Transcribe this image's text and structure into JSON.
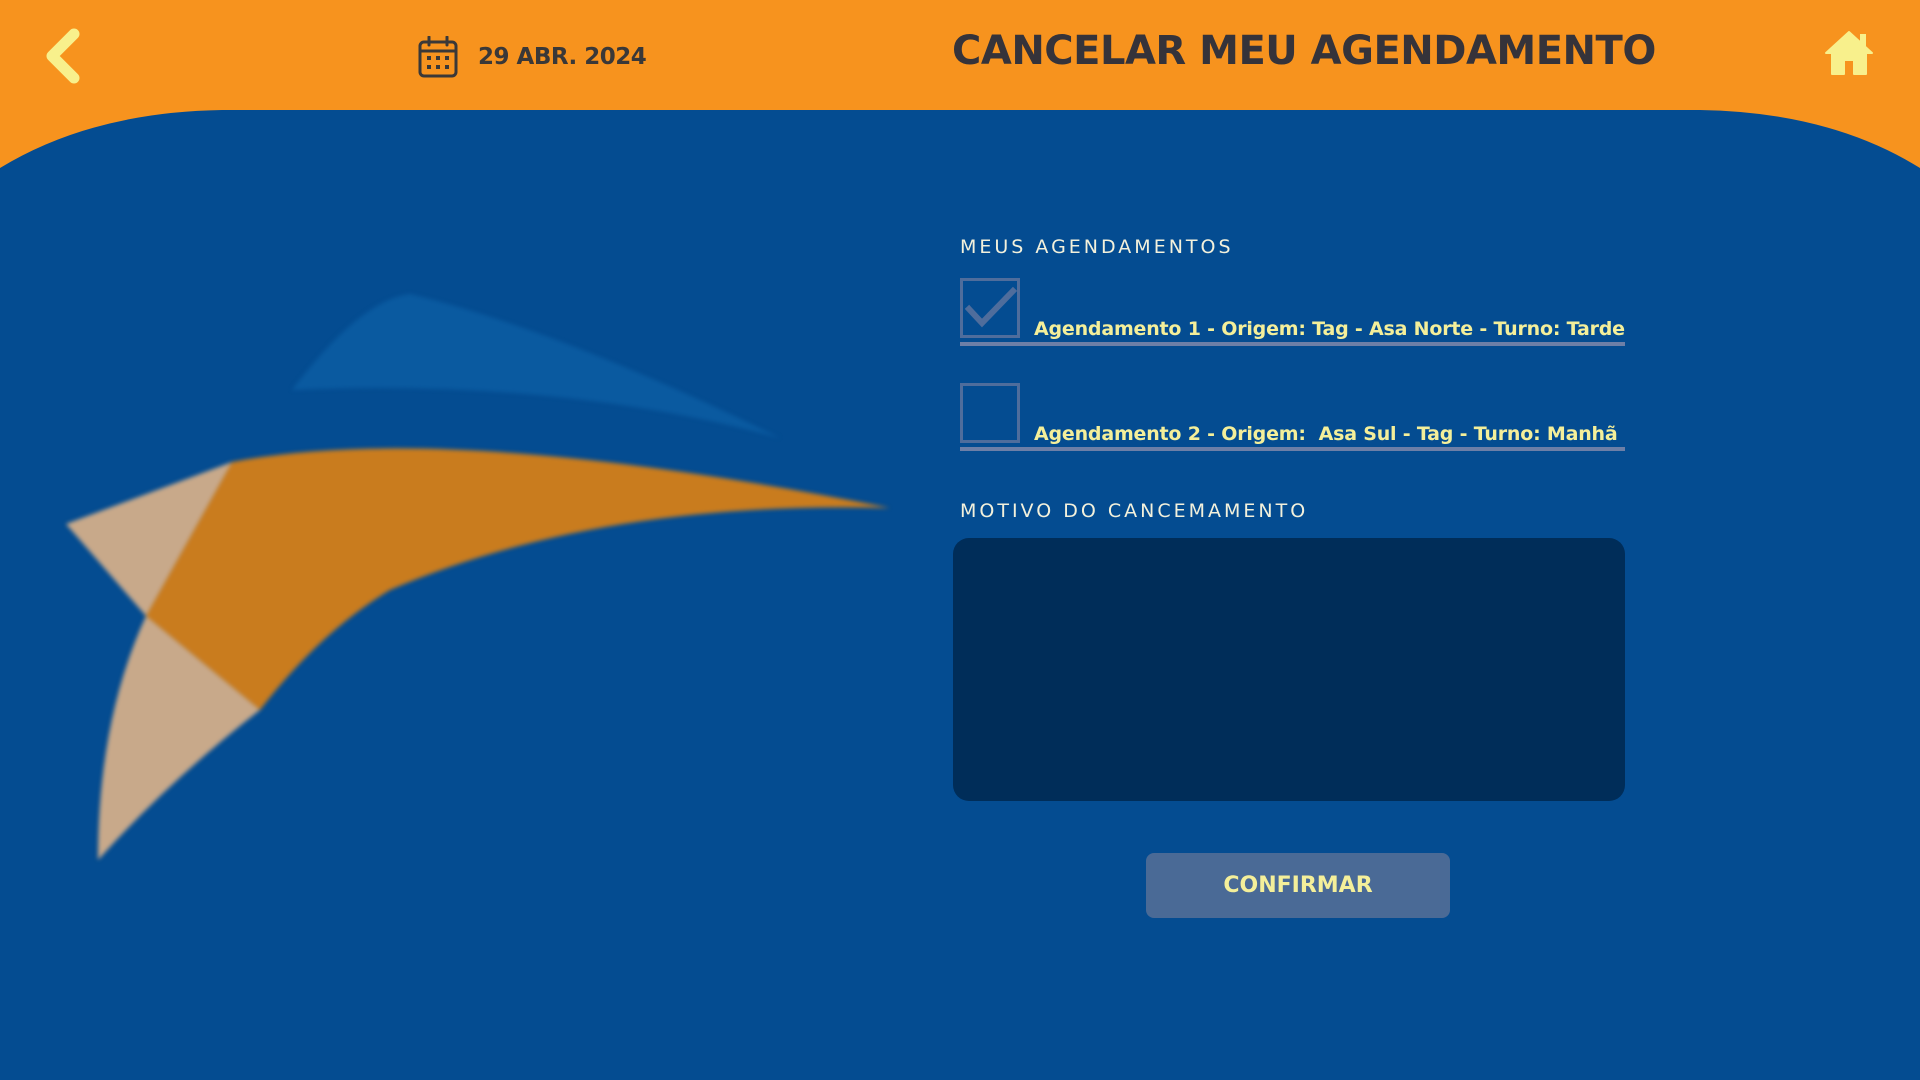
{
  "colors": {
    "header_orange": "#f7931e",
    "background_blue": "#044c91",
    "accent_yellow": "#f4ef9a",
    "dark_text": "#35333a",
    "textarea_bg": "#002d59",
    "button_bg": "#4a6a96"
  },
  "header": {
    "back_icon": "chevron-left-icon",
    "calendar_icon": "calendar-icon",
    "date": "29 ABR. 2024",
    "title": "CANCELAR MEU AGENDAMENTO",
    "home_icon": "home-icon"
  },
  "appointments": {
    "label": "MEUS AGENDAMENTOS",
    "items": [
      {
        "text": "Agendamento 1 - Origem: Tag - Asa Norte - Turno: Tarde",
        "checked": true
      },
      {
        "text": "Agendamento 2 - Origem:  Asa Sul - Tag - Turno: Manhã",
        "checked": false
      }
    ]
  },
  "reason": {
    "label": "MOTIVO DO CANCEMAMENTO",
    "value": ""
  },
  "confirm_label": "CONFIRMAR"
}
